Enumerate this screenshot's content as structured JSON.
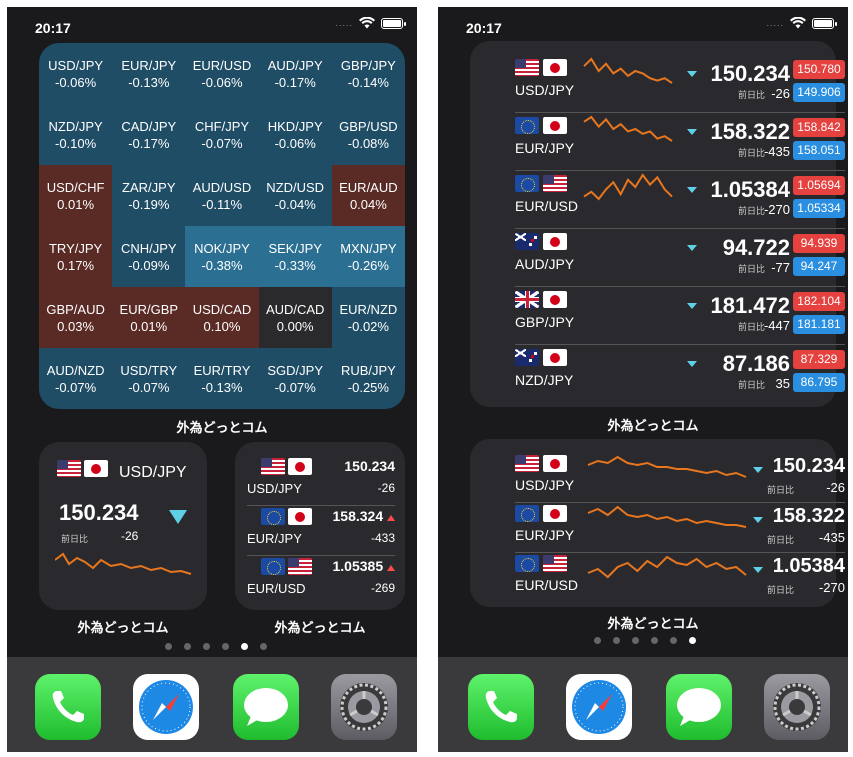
{
  "status": {
    "time": "20:17",
    "signal_dots": "....."
  },
  "heatmap": {
    "cells": [
      {
        "pair": "USD/JPY",
        "chg": "-0.06%",
        "tone": "blue"
      },
      {
        "pair": "EUR/JPY",
        "chg": "-0.13%",
        "tone": "blue"
      },
      {
        "pair": "EUR/USD",
        "chg": "-0.06%",
        "tone": "blue"
      },
      {
        "pair": "AUD/JPY",
        "chg": "-0.17%",
        "tone": "blue"
      },
      {
        "pair": "GBP/JPY",
        "chg": "-0.14%",
        "tone": "blue"
      },
      {
        "pair": "NZD/JPY",
        "chg": "-0.10%",
        "tone": "blue"
      },
      {
        "pair": "CAD/JPY",
        "chg": "-0.17%",
        "tone": "blue"
      },
      {
        "pair": "CHF/JPY",
        "chg": "-0.07%",
        "tone": "blue"
      },
      {
        "pair": "HKD/JPY",
        "chg": "-0.06%",
        "tone": "blue"
      },
      {
        "pair": "GBP/USD",
        "chg": "-0.08%",
        "tone": "blue"
      },
      {
        "pair": "USD/CHF",
        "chg": "0.01%",
        "tone": "red"
      },
      {
        "pair": "ZAR/JPY",
        "chg": "-0.19%",
        "tone": "blue"
      },
      {
        "pair": "AUD/USD",
        "chg": "-0.11%",
        "tone": "blue"
      },
      {
        "pair": "NZD/USD",
        "chg": "-0.04%",
        "tone": "blue"
      },
      {
        "pair": "EUR/AUD",
        "chg": "0.04%",
        "tone": "red"
      },
      {
        "pair": "TRY/JPY",
        "chg": "0.17%",
        "tone": "red"
      },
      {
        "pair": "CNH/JPY",
        "chg": "-0.09%",
        "tone": "blue"
      },
      {
        "pair": "NOK/JPY",
        "chg": "-0.38%",
        "tone": "blue2"
      },
      {
        "pair": "SEK/JPY",
        "chg": "-0.33%",
        "tone": "blue2"
      },
      {
        "pair": "MXN/JPY",
        "chg": "-0.26%",
        "tone": "blue2"
      },
      {
        "pair": "GBP/AUD",
        "chg": "0.03%",
        "tone": "red"
      },
      {
        "pair": "EUR/GBP",
        "chg": "0.01%",
        "tone": "red"
      },
      {
        "pair": "USD/CAD",
        "chg": "0.10%",
        "tone": "red"
      },
      {
        "pair": "AUD/CAD",
        "chg": "0.00%",
        "tone": "dark"
      },
      {
        "pair": "EUR/NZD",
        "chg": "-0.02%",
        "tone": "blue"
      },
      {
        "pair": "AUD/NZD",
        "chg": "-0.07%",
        "tone": "blue"
      },
      {
        "pair": "USD/TRY",
        "chg": "-0.07%",
        "tone": "blue"
      },
      {
        "pair": "EUR/TRY",
        "chg": "-0.13%",
        "tone": "blue"
      },
      {
        "pair": "SGD/JPY",
        "chg": "-0.07%",
        "tone": "blue"
      },
      {
        "pair": "RUB/JPY",
        "chg": "-0.25%",
        "tone": "blue"
      }
    ]
  },
  "app_name": "外為どっとコム",
  "prev_day_label": "前日比",
  "single_widget": {
    "pair": "USD/JPY",
    "flags": [
      "us",
      "jp"
    ],
    "price": "150.234",
    "change": "-26"
  },
  "small_list_widget": {
    "rows": [
      {
        "pair": "USD/JPY",
        "flags": [
          "us",
          "jp"
        ],
        "price": "150.234",
        "change": "-26",
        "arrow": "none"
      },
      {
        "pair": "EUR/JPY",
        "flags": [
          "eu",
          "jp"
        ],
        "price": "158.324",
        "change": "-433",
        "arrow": "up"
      },
      {
        "pair": "EUR/USD",
        "flags": [
          "eu",
          "us"
        ],
        "price": "1.05385",
        "change": "-269",
        "arrow": "up"
      }
    ]
  },
  "large_widget": {
    "rows": [
      {
        "pair": "USD/JPY",
        "flags": [
          "us",
          "jp"
        ],
        "price": "150.234",
        "change": "-26",
        "high": "150.780",
        "low": "149.906"
      },
      {
        "pair": "EUR/JPY",
        "flags": [
          "eu",
          "jp"
        ],
        "price": "158.322",
        "change": "-435",
        "high": "158.842",
        "low": "158.051"
      },
      {
        "pair": "EUR/USD",
        "flags": [
          "eu",
          "us"
        ],
        "price": "1.05384",
        "change": "-270",
        "high": "1.05694",
        "low": "1.05334"
      },
      {
        "pair": "AUD/JPY",
        "flags": [
          "au",
          "jp"
        ],
        "price": "94.722",
        "change": "-77",
        "high": "94.939",
        "low": "94.247"
      },
      {
        "pair": "GBP/JPY",
        "flags": [
          "gb",
          "jp"
        ],
        "price": "181.472",
        "change": "-447",
        "high": "182.104",
        "low": "181.181"
      },
      {
        "pair": "NZD/JPY",
        "flags": [
          "nz",
          "jp"
        ],
        "price": "87.186",
        "change": "35",
        "high": "87.329",
        "low": "86.795"
      }
    ]
  },
  "medium_widget": {
    "rows": [
      {
        "pair": "USD/JPY",
        "flags": [
          "us",
          "jp"
        ],
        "price": "150.234",
        "change": "-26"
      },
      {
        "pair": "EUR/JPY",
        "flags": [
          "eu",
          "jp"
        ],
        "price": "158.322",
        "change": "-435"
      },
      {
        "pair": "EUR/USD",
        "flags": [
          "eu",
          "us"
        ],
        "price": "1.05384",
        "change": "-270"
      }
    ]
  },
  "page_indicator": {
    "left_active": 4,
    "right_active": 5,
    "count": 6
  },
  "dock": [
    {
      "name": "Phone",
      "icon": "phone-icon"
    },
    {
      "name": "Safari",
      "icon": "compass-icon"
    },
    {
      "name": "Messages",
      "icon": "speech-bubble-icon"
    },
    {
      "name": "Settings",
      "icon": "gear-icon"
    }
  ],
  "colors": {
    "sparkline": "#e8761e",
    "down_arrow": "#5fd0e6",
    "up_arrow": "#ff4a4a",
    "high_badge": "#e5413f",
    "low_badge": "#2a8fe0"
  }
}
